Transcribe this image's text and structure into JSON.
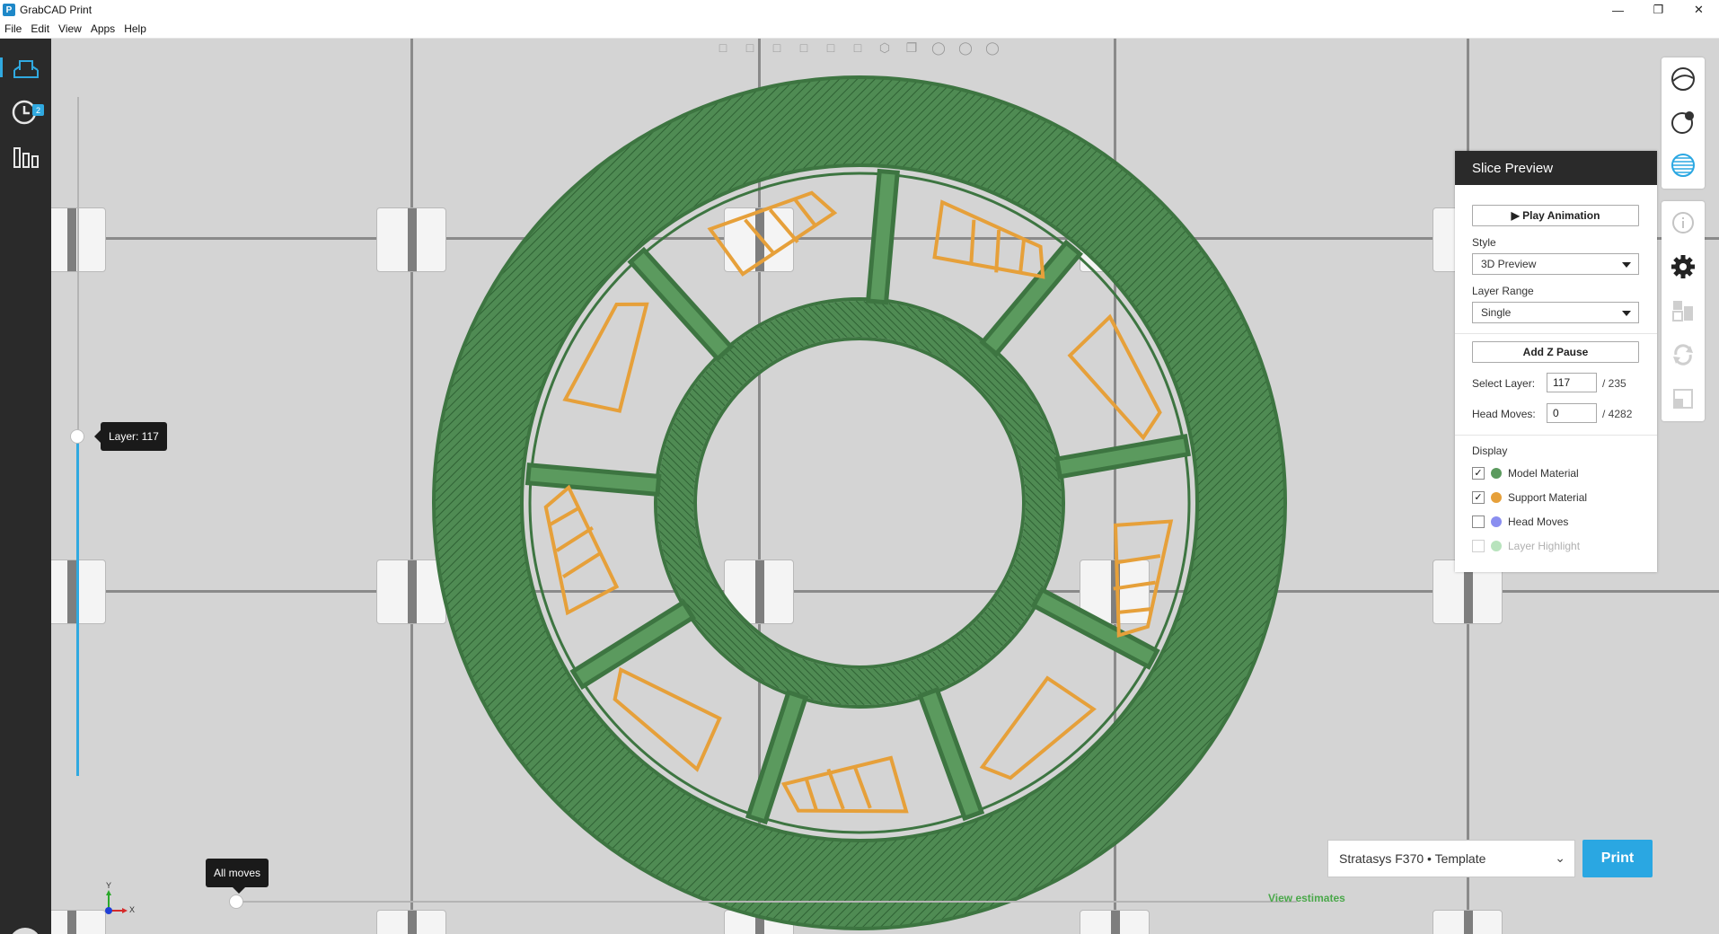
{
  "window": {
    "title": "GrabCAD Print",
    "logo_letter": "P",
    "minimize": "—",
    "maximize": "❐",
    "close": "✕"
  },
  "menu": [
    "File",
    "Edit",
    "View",
    "Apps",
    "Help"
  ],
  "sidebar": {
    "jobs_badge": "2"
  },
  "viewport": {
    "layer_tooltip": "Layer: 117",
    "layer_progress": 0.5,
    "moves_tooltip": "All moves",
    "moves_progress": 0.0,
    "axis_y": "Y",
    "axis_x": "X",
    "view_estimates": "View estimates"
  },
  "printer": {
    "selected": "Stratasys F370 • Template",
    "print_label": "Print"
  },
  "slice_panel": {
    "title": "Slice Preview",
    "play_label": "▶  Play Animation",
    "style_label": "Style",
    "style_value": "3D Preview",
    "range_label": "Layer Range",
    "range_value": "Single",
    "zpause_label": "Add Z Pause",
    "select_layer_label": "Select Layer:",
    "select_layer_value": "117",
    "select_layer_total": "/ 235",
    "head_moves_label": "Head Moves:",
    "head_moves_value": "0",
    "head_moves_total": "/ 4282",
    "display_label": "Display",
    "display_items": [
      {
        "label": "Model Material",
        "checked": true,
        "color": "#5b9a5e"
      },
      {
        "label": "Support Material",
        "checked": true,
        "color": "#e6a03a"
      },
      {
        "label": "Head Moves",
        "checked": false,
        "color": "#8a8ef0"
      },
      {
        "label": "Layer Highlight",
        "checked": false,
        "color": "#b8e3bd"
      }
    ]
  },
  "colors": {
    "accent": "#2aa7e2",
    "model": "#4e8a52",
    "support": "#e6a03a",
    "estimates": "#4aa84a"
  }
}
